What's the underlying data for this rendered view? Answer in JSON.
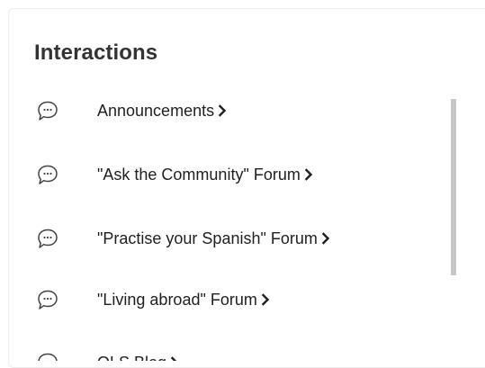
{
  "panel": {
    "title": "Interactions"
  },
  "items": [
    {
      "label": "Announcements",
      "icon": "chat-bubble-icon"
    },
    {
      "label": "\"Ask the Community\" Forum",
      "icon": "chat-bubble-icon"
    },
    {
      "label": "\"Practise your Spanish\" Forum",
      "icon": "chat-bubble-icon"
    },
    {
      "label": "\"Living abroad\" Forum",
      "icon": "chat-bubble-icon"
    },
    {
      "label": "OLS Blog",
      "icon": "chat-bubble-icon"
    }
  ],
  "colors": {
    "title": "#333333",
    "text": "#1f1f1f",
    "icon": "#444444",
    "scrollbar": "#c6c6c6"
  }
}
